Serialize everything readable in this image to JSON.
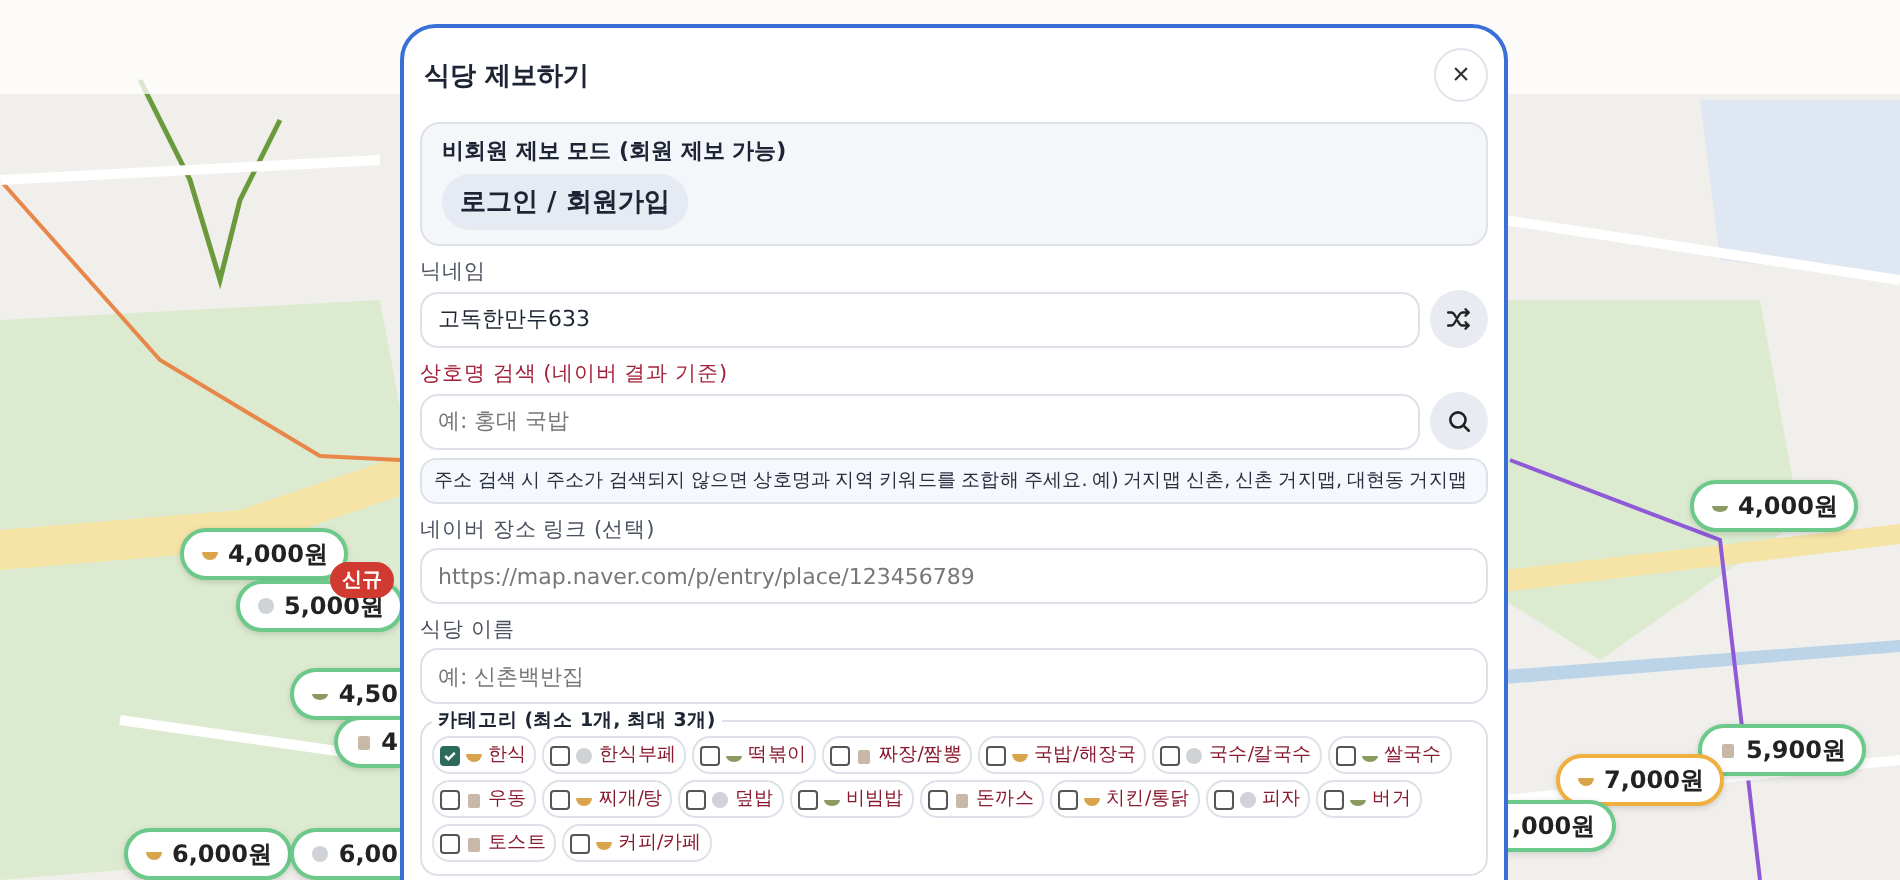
{
  "map_pins": [
    {
      "price": "4,000원",
      "color": "#6cc98a"
    },
    {
      "price": "5,000원",
      "color": "#6cc98a",
      "badge": "신규"
    },
    {
      "price": "4,50",
      "color": "#6cc98a"
    },
    {
      "price": "4",
      "color": "#6cc98a"
    },
    {
      "price": "6,000원",
      "color": "#6cc98a"
    },
    {
      "price": "6,00",
      "color": "#6cc98a"
    },
    {
      "price": "4,000원",
      "color": "#6cc98a"
    },
    {
      "price": "5,900원",
      "color": "#6cc98a"
    },
    {
      "price": "7,000원",
      "color": "#f0b040"
    },
    {
      "price": ",000원",
      "color": "#6cc98a"
    }
  ],
  "dialog": {
    "title": "식당 제보하기",
    "close": "×",
    "guest_notice": {
      "text": "비회원 제보 모드 (회원 제보 가능)",
      "button": "로그인 / 회원가입"
    },
    "nickname": {
      "label": "닉네임",
      "value": "고독한만두633"
    },
    "name_search": {
      "label": "상호명 검색 (네이버 결과 기준)",
      "placeholder": "예: 홍대 국밥",
      "hint": "주소 검색 시 주소가 검색되지 않으면 상호명과 지역 키워드를 조합해 주세요. 예) 거지맵 신촌, 신촌 거지맵, 대현동 거지맵"
    },
    "naver_link": {
      "label": "네이버 장소 링크 (선택)",
      "placeholder": "https://map.naver.com/p/entry/place/123456789"
    },
    "restaurant_name": {
      "label": "식당 이름",
      "placeholder": "예: 신촌백반집"
    },
    "categories": {
      "legend": "카테고리 (최소 1개, 최대 3개)",
      "items": [
        {
          "label": "한식",
          "checked": true
        },
        {
          "label": "한식부페",
          "checked": false
        },
        {
          "label": "떡볶이",
          "checked": false
        },
        {
          "label": "짜장/짬뽕",
          "checked": false
        },
        {
          "label": "국밥/해장국",
          "checked": false
        },
        {
          "label": "국수/칼국수",
          "checked": false
        },
        {
          "label": "쌀국수",
          "checked": false
        },
        {
          "label": "우동",
          "checked": false
        },
        {
          "label": "찌개/탕",
          "checked": false
        },
        {
          "label": "덮밥",
          "checked": false
        },
        {
          "label": "비빔밥",
          "checked": false
        },
        {
          "label": "돈까스",
          "checked": false
        },
        {
          "label": "치킨/통닭",
          "checked": false
        },
        {
          "label": "피자",
          "checked": false
        },
        {
          "label": "버거",
          "checked": false
        },
        {
          "label": "토스트",
          "checked": false
        },
        {
          "label": "커피/카페",
          "checked": false
        }
      ]
    }
  }
}
